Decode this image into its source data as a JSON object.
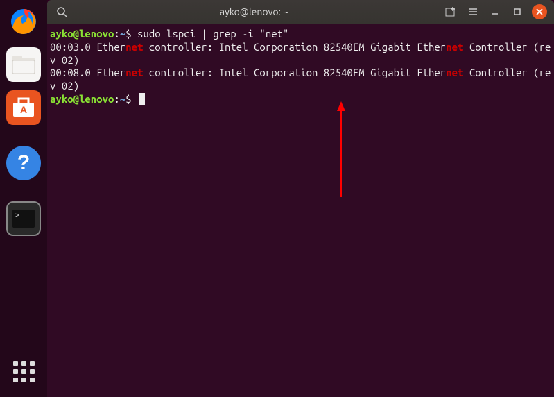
{
  "window": {
    "title": "ayko@lenovo: ~"
  },
  "prompt": {
    "user": "ayko@lenovo",
    "sep": ":",
    "path": "~",
    "dollar": "$"
  },
  "command": "sudo lspci | grep -i \"net\"",
  "output": [
    {
      "pre": "00:03.0 Ether",
      "match": "net",
      "mid": " controller: Intel Corporation 82540EM Gigabit Ether",
      "match2": "net",
      "post": " Controller (rev 02)"
    },
    {
      "pre": "00:08.0 Ether",
      "match": "net",
      "mid": " controller: Intel Corporation 82540EM Gigabit Ether",
      "match2": "net",
      "post": " Controller (rev 02)"
    }
  ],
  "dock": {
    "firefox": "firefox-icon",
    "files": "files-icon",
    "software": "software-icon",
    "help": "help-icon",
    "terminal": "terminal-icon",
    "apps": "apps-icon"
  }
}
